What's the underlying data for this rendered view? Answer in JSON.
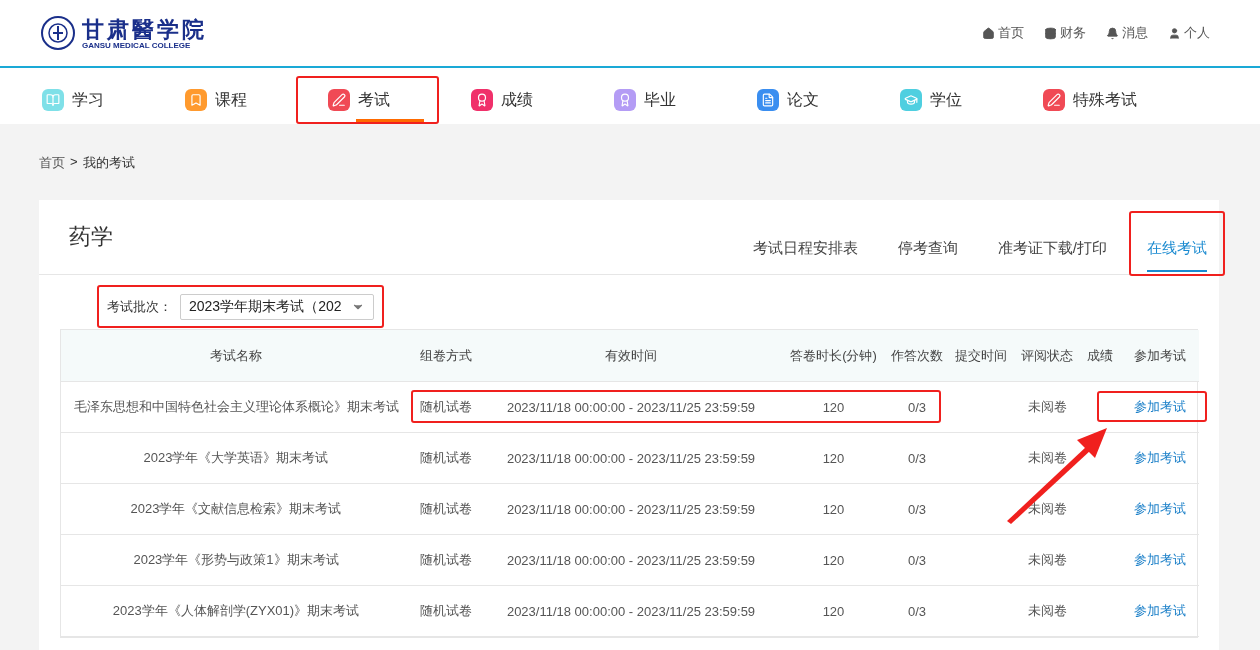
{
  "logo": {
    "title": "甘肃醫学院",
    "subtitle": "GANSU MEDICAL COLLEGE"
  },
  "top_links": [
    {
      "label": "首页"
    },
    {
      "label": "财务"
    },
    {
      "label": "消息"
    },
    {
      "label": "个人"
    }
  ],
  "nav": [
    {
      "label": "学习",
      "color": "#7fe0e8",
      "selected": false,
      "highlighted": false
    },
    {
      "label": "课程",
      "color": "#ff9a2e",
      "selected": false,
      "highlighted": false
    },
    {
      "label": "考试",
      "color": "#f04a55",
      "selected": true,
      "highlighted": true
    },
    {
      "label": "成绩",
      "color": "#f0306a",
      "selected": false,
      "highlighted": false
    },
    {
      "label": "毕业",
      "color": "#b49cf5",
      "selected": false,
      "highlighted": false
    },
    {
      "label": "论文",
      "color": "#3a8ef0",
      "selected": false,
      "highlighted": false
    },
    {
      "label": "学位",
      "color": "#4fcfe0",
      "selected": false,
      "highlighted": false
    },
    {
      "label": "特殊考试",
      "color": "#f04a55",
      "selected": false,
      "highlighted": false
    }
  ],
  "breadcrumb": {
    "items": [
      "首页",
      "我的考试"
    ],
    "separator": ">"
  },
  "card": {
    "title": "药学",
    "tabs": [
      {
        "label": "考试日程安排表",
        "selected": false,
        "highlighted": false
      },
      {
        "label": "停考查询",
        "selected": false,
        "highlighted": false
      },
      {
        "label": "准考证下载/打印",
        "selected": false,
        "highlighted": false
      },
      {
        "label": "在线考试",
        "selected": true,
        "highlighted": true
      }
    ]
  },
  "filter": {
    "label": "考试批次：",
    "value": "2023学年期末考试（202",
    "highlighted": true
  },
  "table": {
    "columns": [
      "考试名称",
      "组卷方式",
      "有效时间",
      "答卷时长(分钟)",
      "作答次数",
      "提交时间",
      "评阅状态",
      "成绩",
      "参加考试"
    ],
    "rows": [
      {
        "name": "毛泽东思想和中国特色社会主义理论体系概论》期末考试",
        "mode": "随机试卷",
        "time": "2023/11/18 00:00:00 - 2023/11/25 23:59:59",
        "duration": "120",
        "attempts": "0/3",
        "status": "未阅卷",
        "action": "参加考试",
        "highlighted": true,
        "action_highlighted": true
      },
      {
        "name": "2023学年《大学英语》期末考试",
        "mode": "随机试卷",
        "time": "2023/11/18 00:00:00 - 2023/11/25 23:59:59",
        "duration": "120",
        "attempts": "0/3",
        "status": "未阅卷",
        "action": "参加考试",
        "highlighted": false,
        "action_highlighted": false
      },
      {
        "name": "2023学年《文献信息检索》期末考试",
        "mode": "随机试卷",
        "time": "2023/11/18 00:00:00 - 2023/11/25 23:59:59",
        "duration": "120",
        "attempts": "0/3",
        "status": "未阅卷",
        "action": "参加考试",
        "highlighted": false,
        "action_highlighted": false
      },
      {
        "name": "2023学年《形势与政策1》期末考试",
        "mode": "随机试卷",
        "time": "2023/11/18 00:00:00 - 2023/11/25 23:59:59",
        "duration": "120",
        "attempts": "0/3",
        "status": "未阅卷",
        "action": "参加考试",
        "highlighted": false,
        "action_highlighted": false
      },
      {
        "name": "2023学年《人体解剖学(ZYX01)》期末考试",
        "mode": "随机试卷",
        "time": "2023/11/18 00:00:00 - 2023/11/25 23:59:59",
        "duration": "120",
        "attempts": "0/3",
        "status": "未阅卷",
        "action": "参加考试",
        "highlighted": false,
        "action_highlighted": false
      }
    ]
  }
}
